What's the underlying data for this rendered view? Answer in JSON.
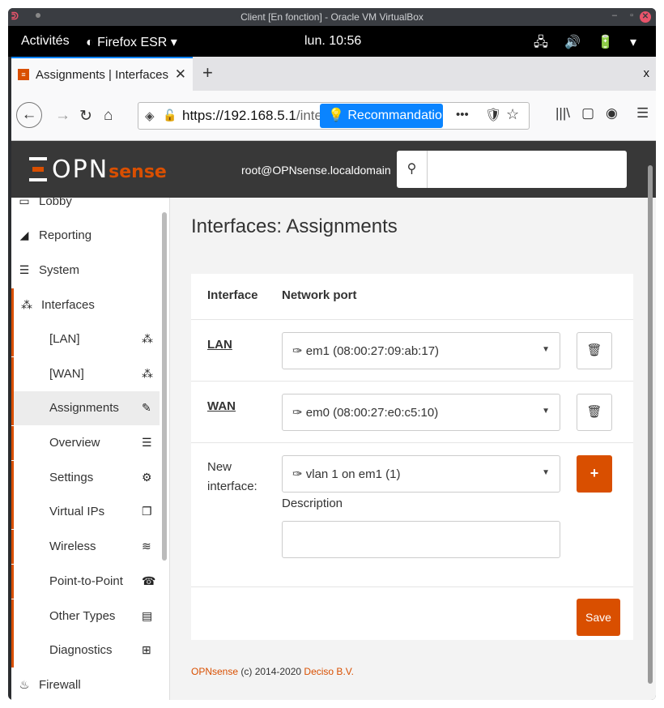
{
  "vbox": {
    "title": "Client [En fonction] - Oracle VM VirtualBox",
    "minimize": "–",
    "maximize": "▫",
    "close": "✕"
  },
  "gnome": {
    "activities": "Activités",
    "app": "Firefox ESR ▾",
    "clock": "lun. 10:56",
    "tray": "🖧 🔊 🔋 ▾"
  },
  "browser": {
    "tab_title": "Assignments | Interfaces",
    "tab_close": "✕",
    "new_tab": "+",
    "window_close": "x",
    "url_host": "https://192.168.5.1",
    "url_rest": "/inte",
    "recommendation": "💡 Recommandation",
    "more": "•••",
    "pocket": "🛡",
    "star": "☆",
    "library": "|||\\",
    "sidebar_icon": "▢",
    "account": "◉",
    "menu": "☰"
  },
  "header": {
    "logo_main": "OPN",
    "logo_accent": "sense",
    "user": "root@OPNsense.localdomain",
    "search_placeholder": ""
  },
  "sidebar": {
    "lobby": "Lobby",
    "reporting": "Reporting",
    "system": "System",
    "interfaces": "Interfaces",
    "sub": [
      {
        "label": "[LAN]",
        "icon": "sitemap-icon"
      },
      {
        "label": "[WAN]",
        "icon": "sitemap-icon"
      },
      {
        "label": "Assignments",
        "icon": "pencil-icon"
      },
      {
        "label": "Overview",
        "icon": "list-icon"
      },
      {
        "label": "Settings",
        "icon": "cogs-icon"
      },
      {
        "label": "Virtual IPs",
        "icon": "copy-icon"
      },
      {
        "label": "Wireless",
        "icon": "wifi-icon"
      },
      {
        "label": "Point-to-Point",
        "icon": "phone-icon"
      },
      {
        "label": "Other Types",
        "icon": "archive-icon"
      },
      {
        "label": "Diagnostics",
        "icon": "medkit-icon"
      }
    ],
    "firewall": "Firewall"
  },
  "main": {
    "title": "Interfaces: Assignments",
    "col_interface": "Interface",
    "col_network_port": "Network port",
    "rows": [
      {
        "interface": "LAN",
        "port": "em1 (08:00:27:09:ab:17)"
      },
      {
        "interface": "WAN",
        "port": "em0 (08:00:27:e0:c5:10)"
      }
    ],
    "new_interface_label": "New interface:",
    "new_port": "vlan 1 on em1 (1)",
    "description_label": "Description",
    "description_value": "",
    "save_label": "Save",
    "add_label": "+"
  },
  "footer": {
    "brand": "OPNsense",
    "copy": " (c) 2014-2020 ",
    "company": "Deciso B.V."
  }
}
